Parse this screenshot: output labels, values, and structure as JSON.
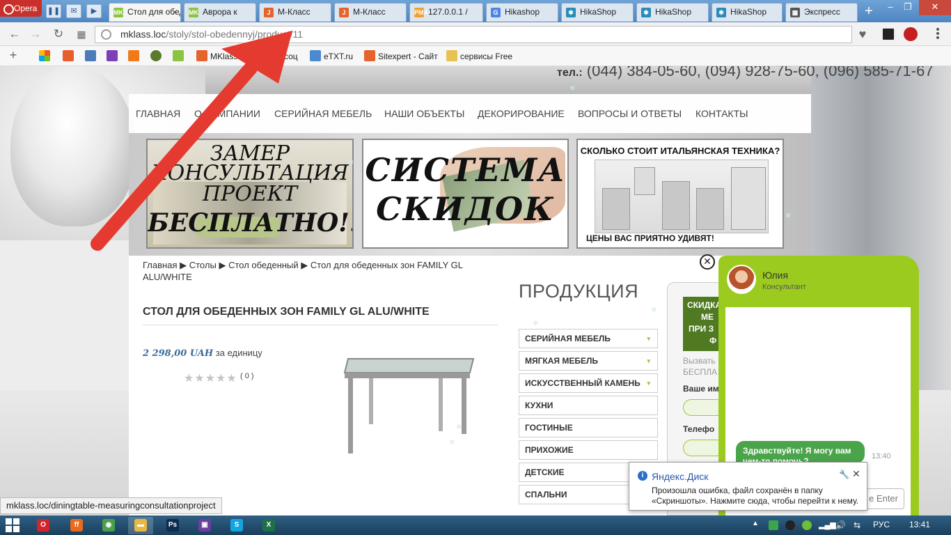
{
  "browser": {
    "menu_label": "Opera",
    "tabs": [
      {
        "title": "Стол для обеденных",
        "favicon": "MK",
        "favicon_color": "#8bc53f",
        "active": true
      },
      {
        "title": "Аврора к",
        "favicon": "MK",
        "favicon_color": "#8bc53f",
        "active": false
      },
      {
        "title": "М-Класс",
        "favicon": "J",
        "favicon_color": "#e5632d",
        "active": false
      },
      {
        "title": "М-Класс",
        "favicon": "J",
        "favicon_color": "#e5632d",
        "active": false
      },
      {
        "title": "127.0.0.1 /",
        "favicon": "PMA",
        "favicon_color": "#f0a030",
        "active": false
      },
      {
        "title": "Hikashop",
        "favicon": "G",
        "favicon_color": "#4a86e8",
        "active": false
      },
      {
        "title": "HikaShop",
        "favicon": "✱",
        "favicon_color": "#2a8ab8",
        "active": false
      },
      {
        "title": "HikaShop",
        "favicon": "✱",
        "favicon_color": "#2a8ab8",
        "active": false
      },
      {
        "title": "HikaShop",
        "favicon": "✱",
        "favicon_color": "#2a8ab8",
        "active": false
      },
      {
        "title": "Экспресс",
        "favicon": "▦",
        "favicon_color": "#555555",
        "active": false
      }
    ],
    "url_host": "mklass.loc",
    "url_path": "/stoly/stol-obedennyj/product/11",
    "bookmarks": [
      {
        "label": "MKlass",
        "icon": "joomla-icon"
      },
      {
        "label": "соц",
        "icon": "vk-icon"
      },
      {
        "label": "eTXT.ru",
        "icon": "pencil-icon"
      },
      {
        "label": "Sitexpert - Сайт",
        "icon": "joomla-icon"
      },
      {
        "label": "сервисы Free",
        "icon": "folder-icon"
      }
    ],
    "status_url": "mklass.loc/diningtable-measuringconsultationproject"
  },
  "site": {
    "phone_prefix": "тел.:",
    "phones": "(044) 384-05-60, (094) 928-75-60, (096) 585-71-67",
    "nav": [
      "ГЛАВНАЯ",
      "О КОМПАНИИ",
      "СЕРИЙНАЯ МЕБЕЛЬ",
      "НАШИ ОБЪЕКТЫ",
      "ДЕКОРИРОВАНИЕ",
      "ВОПРОСЫ И ОТВЕТЫ",
      "КОНТАКТЫ"
    ],
    "promo1": {
      "line1": "ЗАМЕР",
      "line2": "КОНСУЛЬТАЦИЯ",
      "line3": "ПРОЕКТ",
      "line4": "БЕСПЛАТНО!!!"
    },
    "promo2": {
      "line1": "СИСТЕМА",
      "line2": "СКИДОК"
    },
    "promo3": {
      "title": "СКОЛЬКО СТОИТ ИТАЛЬЯНСКАЯ ТЕХНИКА?",
      "footer": "ЦЕНЫ ВАС ПРИЯТНО УДИВЯТ!"
    },
    "breadcrumb": [
      "Главная",
      "Столы",
      "Стол обеденный",
      "Стол для обеденных зон FAMILY GL ALU/WHITE"
    ],
    "product": {
      "title": "СТОЛ ДЛЯ ОБЕДЕННЫХ ЗОН FAMILY GL ALU/WHITE",
      "price": "2 298,00 UAH",
      "price_unit": "за единицу",
      "votes": "( 0 )",
      "rating": 0,
      "rating_max": 5
    },
    "sidebar": {
      "heading": "ПРОДУКЦИЯ",
      "categories": [
        {
          "label": "СЕРИЙНАЯ МЕБЕЛЬ",
          "has_sub": true
        },
        {
          "label": "МЯГКАЯ МЕБЕЛЬ",
          "has_sub": true
        },
        {
          "label": "ИСКУССТВЕННЫЙ КАМЕНЬ",
          "has_sub": true
        },
        {
          "label": "КУХНИ",
          "has_sub": false
        },
        {
          "label": "ГОСТИНЫЕ",
          "has_sub": false
        },
        {
          "label": "ПРИХОЖИЕ",
          "has_sub": false
        },
        {
          "label": "ДЕТСКИЕ",
          "has_sub": false
        },
        {
          "label": "СПАЛЬНИ",
          "has_sub": false
        }
      ]
    },
    "callback_form": {
      "banner_lines": [
        "СКИДКА",
        "МЕ",
        "ПРИ З",
        "Ф"
      ],
      "text_lines": [
        "Вызвать",
        "БЕСПЛА"
      ],
      "name_label": "Ваше им",
      "phone_label": "Телефо"
    }
  },
  "chat": {
    "operator_name": "Юлия",
    "operator_role": "Консультант",
    "message": "Здравствуйте! Я могу вам чем-то помочь?",
    "time": "13:40",
    "send_label": "e Enter",
    "accent_color": "#9ccb1f"
  },
  "notification": {
    "title": "Яндекс.Диск",
    "body": "Произошла ошибка, файл сохранён в папку «Скриншоты». Нажмите сюда, чтобы перейти к нему."
  },
  "taskbar": {
    "language": "РУС",
    "clock": "13:41",
    "apps": [
      {
        "name": "opera",
        "label": "O",
        "color": "#d3232c"
      },
      {
        "name": "firefox",
        "label": "ff",
        "color": "#e66b1e"
      },
      {
        "name": "chrome",
        "label": "◉",
        "color": "#4aa049"
      },
      {
        "name": "explorer",
        "label": "▬",
        "color": "#e8b845"
      },
      {
        "name": "photoshop",
        "label": "Ps",
        "color": "#0c2d4d"
      },
      {
        "name": "save",
        "label": "▣",
        "color": "#6a3fa0"
      },
      {
        "name": "skype",
        "label": "S",
        "color": "#12a5e3"
      },
      {
        "name": "excel",
        "label": "X",
        "color": "#1e7145"
      }
    ]
  }
}
